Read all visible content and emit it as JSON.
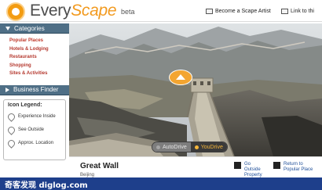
{
  "header": {
    "brand_every": "Every",
    "brand_scape": "Scape",
    "beta": "beta",
    "link_artist": "Become a Scape Artist",
    "link_page": "Link to thi"
  },
  "sidebar": {
    "categories_title": "Categories",
    "categories": [
      "Popular Places",
      "Hotels & Lodging",
      "Restaurants",
      "Shopping",
      "Sites & Activities"
    ],
    "business_title": "Business Finder",
    "legend": {
      "title": "Icon Legend:",
      "items": [
        "Experience Inside",
        "See Outside",
        "Approx. Location"
      ]
    }
  },
  "viewer": {
    "auto_label": "AutoDrive",
    "you_label": "YouDrive",
    "icons": [
      "up-arrow-icon"
    ]
  },
  "info": {
    "title": "Great Wall",
    "subtitle": "Beijing",
    "go_outside": "Go\nOutside\nProperty",
    "return_label": "Return to\nPopular Place"
  },
  "watermark": {
    "text": "奇客发现 diglog.com"
  },
  "colors": {
    "panel": "#4f6f86",
    "accent_orange": "#f29a1f",
    "link_red": "#b5392f",
    "watermark_bar": "#1e3f8b"
  }
}
